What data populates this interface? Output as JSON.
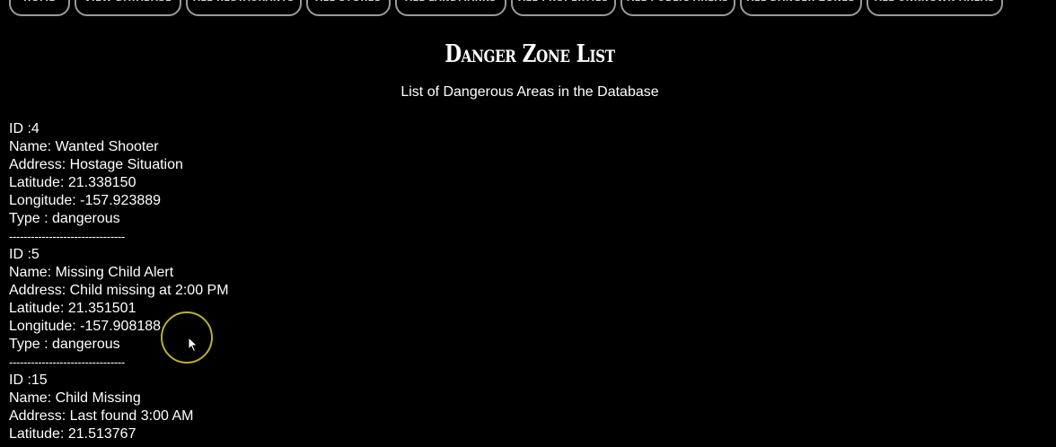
{
  "nav": {
    "items": [
      {
        "label": "Home"
      },
      {
        "label": "View Database"
      },
      {
        "label": "All Restaurants"
      },
      {
        "label": "All Stores"
      },
      {
        "label": "All Landmarks"
      },
      {
        "label": "All Properties"
      },
      {
        "label": "All Public Areas"
      },
      {
        "label": "All Danger Zones"
      },
      {
        "label": "All Unknown Areas"
      }
    ]
  },
  "header": {
    "title": "Danger Zone List",
    "subtitle": "List of Dangerous Areas in the Database"
  },
  "records": [
    {
      "id_line": "ID :4",
      "name_line": "Name: Wanted Shooter",
      "address_line": "Address: Hostage Situation",
      "latitude_line": "Latitude: 21.338150",
      "longitude_line": "Longitude: -157.923889",
      "type_line": "Type : dangerous",
      "separator": "--------------------------------"
    },
    {
      "id_line": "ID :5",
      "name_line": "Name: Missing Child Alert",
      "address_line": "Address: Child missing at 2:00 PM",
      "latitude_line": "Latitude: 21.351501",
      "longitude_line": "Longitude: -157.908188",
      "type_line": "Type : dangerous",
      "separator": "--------------------------------"
    },
    {
      "id_line": "ID :15",
      "name_line": "Name: Child Missing",
      "address_line": "Address: Last found 3:00 AM",
      "latitude_line": "Latitude: 21.513767"
    }
  ]
}
